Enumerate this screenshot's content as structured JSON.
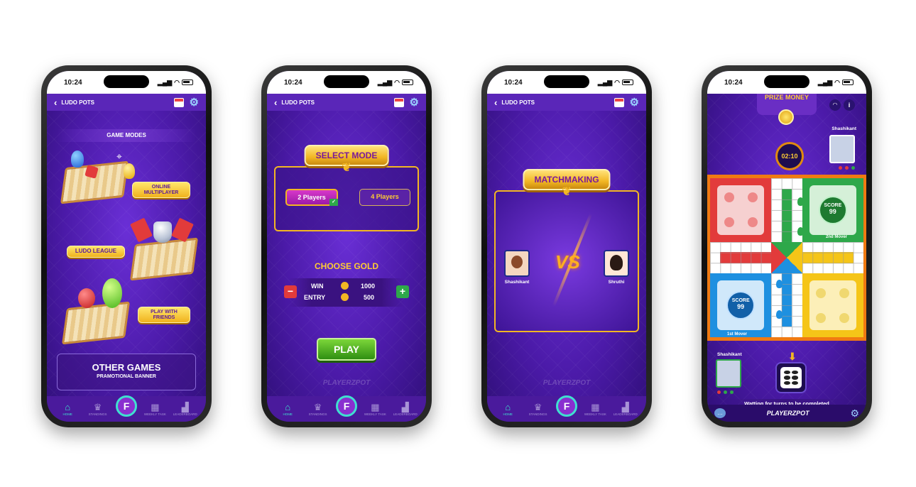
{
  "status_time": "10:24",
  "header_title": "LUDO POTS",
  "nav": {
    "home": "HOME",
    "standings": "STANDINGS",
    "center": "F",
    "weekly_task": "WEEKLY TASK",
    "leaderboard": "LEADERBOARD"
  },
  "screen1": {
    "section_title": "GAME MODES",
    "modes": [
      {
        "label": "ONLINE MULTIPLAYER"
      },
      {
        "label": "LUDO LEAGUE"
      },
      {
        "label": "PLAY WITH FRIENDS"
      }
    ],
    "other_games_title": "OTHER GAMES",
    "other_games_sub": "PRAMOTIONAL BANNER"
  },
  "screen2": {
    "title": "SELECT MODE",
    "option_a": "2 Players",
    "option_b": "4 Players",
    "choose_gold": "CHOOSE GOLD",
    "win_label": "WIN",
    "win_value": "1000",
    "entry_label": "ENTRY",
    "entry_value": "500",
    "minus": "−",
    "plus": "+",
    "play": "PLAY",
    "brand": "PLAYERZPOT"
  },
  "screen3": {
    "title": "MATCHMAKING",
    "player_left": "Shashikant",
    "player_right": "Shruthi",
    "vs": "VS",
    "brand": "PLAYERZPOT"
  },
  "screen4": {
    "prize_money": "PRIZE MONEY",
    "timer": "02:10",
    "top_player": "Shashikant",
    "bottom_player": "Shashikant",
    "score_label": "SCORE",
    "score_green": "99",
    "score_blue": "99",
    "green_caption": "2nd Mover",
    "blue_caption": "1st Mover",
    "waiting": "Watting for turns to be completed",
    "brand": "PLAYERZPOT"
  },
  "colors": {
    "purple_bg": "#4b1aa8",
    "gold": "#f2b623",
    "teal": "#3fe0d0",
    "ludo_red": "#e23b3b",
    "ludo_green": "#2ea84a",
    "ludo_blue": "#1e90e0",
    "ludo_yellow": "#f5c518"
  }
}
